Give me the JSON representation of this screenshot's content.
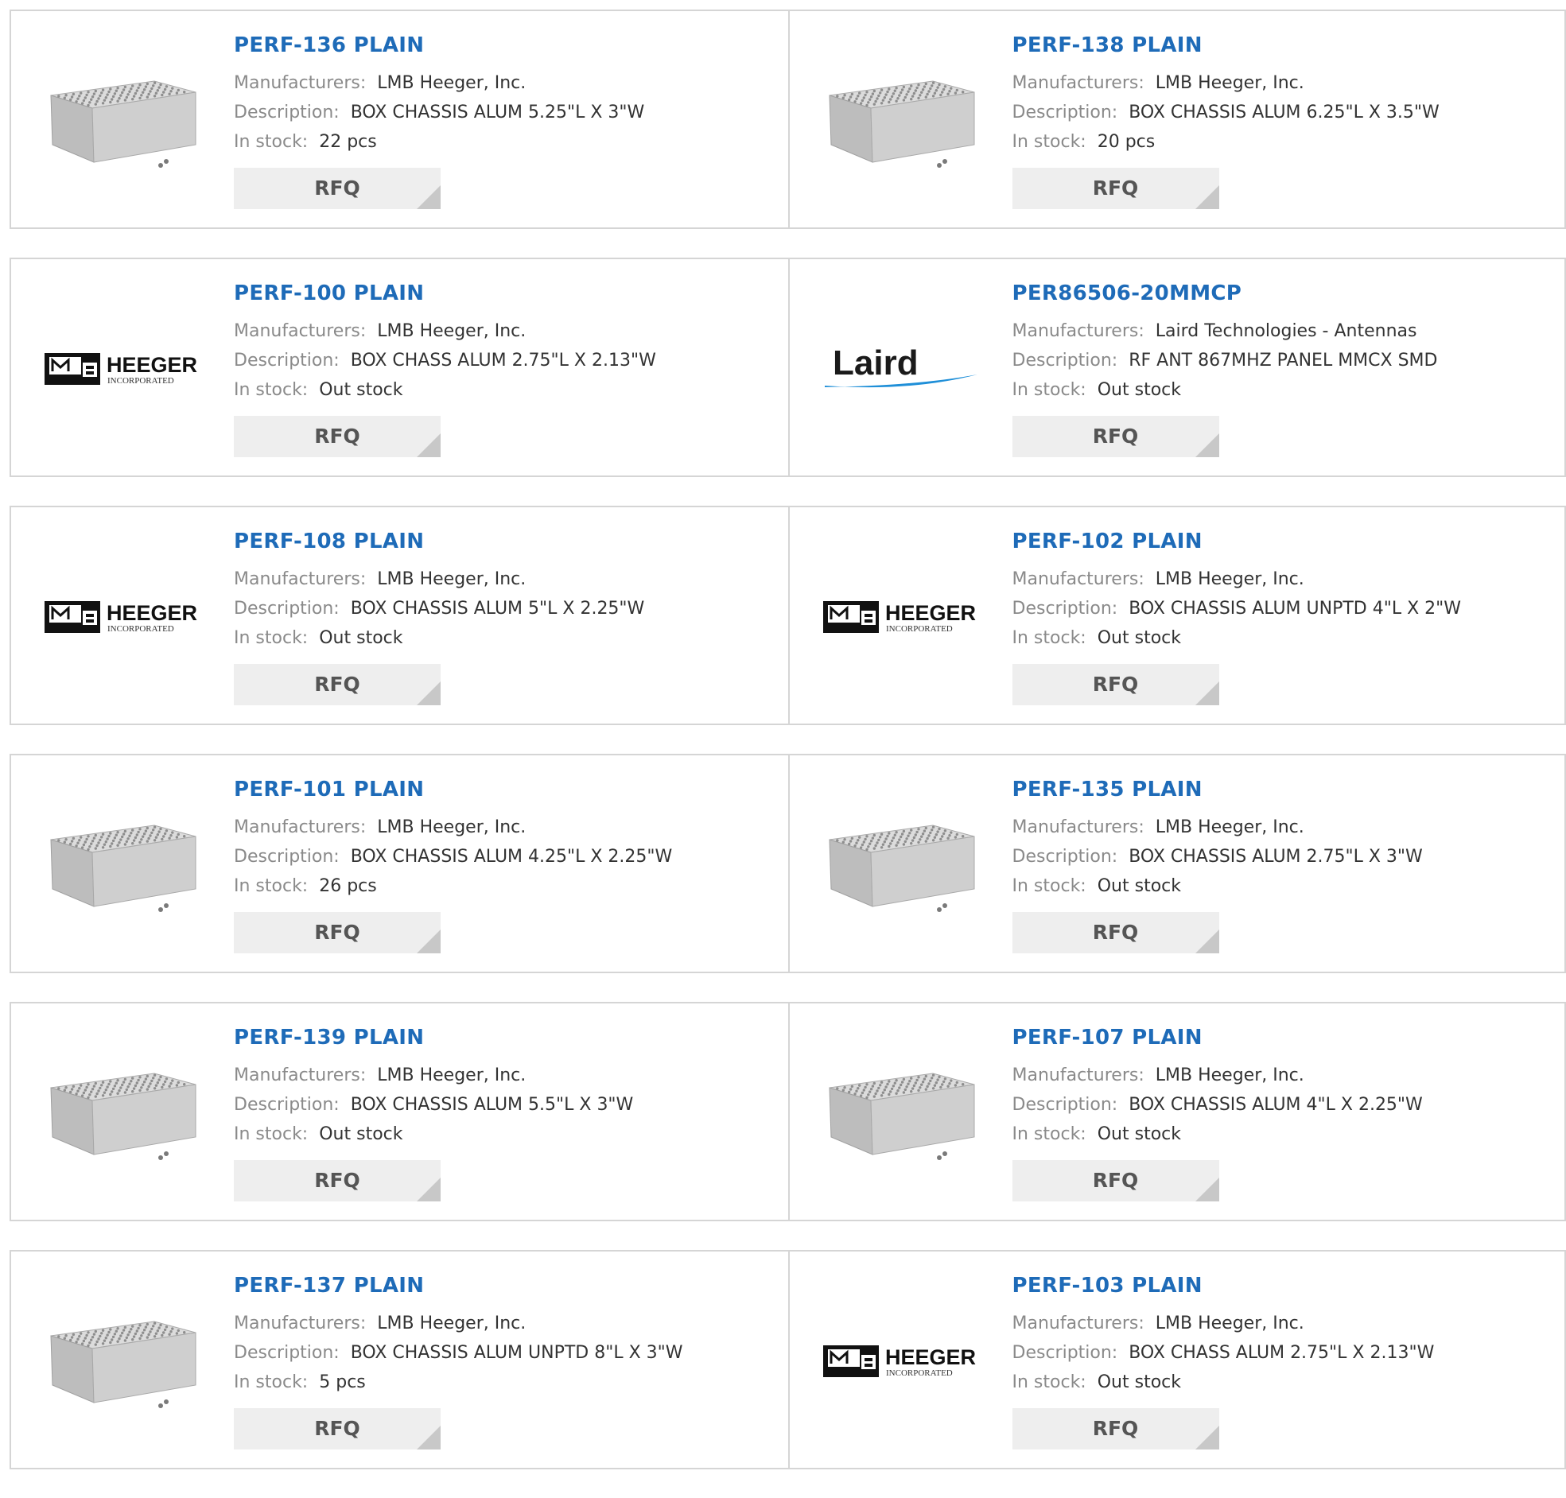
{
  "labels": {
    "manufacturers": "Manufacturers:",
    "description": "Description:",
    "in_stock": "In stock:",
    "rfq": "RFQ"
  },
  "logos": {
    "heeger_word": "HEEGER",
    "heeger_sub": "INCORPORATED",
    "laird_word": "Laird"
  },
  "colors": {
    "title": "#1e6bb8",
    "label": "#8a8a8a",
    "value": "#333333",
    "button_bg": "#eeeeee",
    "border": "#d5d5d5"
  },
  "products": [
    {
      "part": "PERF-136 PLAIN",
      "manufacturer": "LMB Heeger, Inc.",
      "description": "BOX CHASSIS ALUM 5.25\"L X 3\"W",
      "stock": "22 pcs",
      "image": "chassis-box-icon"
    },
    {
      "part": "PERF-138 PLAIN",
      "manufacturer": "LMB Heeger, Inc.",
      "description": "BOX CHASSIS ALUM 6.25\"L X 3.5\"W",
      "stock": "20 pcs",
      "image": "chassis-box-icon"
    },
    {
      "part": "PERF-100 PLAIN",
      "manufacturer": "LMB Heeger, Inc.",
      "description": "BOX CHASS ALUM 2.75\"L X 2.13\"W",
      "stock": "Out stock",
      "image": "heeger-logo"
    },
    {
      "part": "PER86506-20MMCP",
      "manufacturer": "Laird Technologies - Antennas",
      "description": "RF ANT 867MHZ PANEL MMCX SMD",
      "stock": "Out stock",
      "image": "laird-logo"
    },
    {
      "part": "PERF-108 PLAIN",
      "manufacturer": "LMB Heeger, Inc.",
      "description": "BOX CHASSIS ALUM 5\"L X 2.25\"W",
      "stock": "Out stock",
      "image": "heeger-logo"
    },
    {
      "part": "PERF-102 PLAIN",
      "manufacturer": "LMB Heeger, Inc.",
      "description": "BOX CHASSIS ALUM UNPTD 4\"L X 2\"W",
      "stock": "Out stock",
      "image": "heeger-logo"
    },
    {
      "part": "PERF-101 PLAIN",
      "manufacturer": "LMB Heeger, Inc.",
      "description": "BOX CHASSIS ALUM 4.25\"L X 2.25\"W",
      "stock": "26 pcs",
      "image": "chassis-box-icon"
    },
    {
      "part": "PERF-135 PLAIN",
      "manufacturer": "LMB Heeger, Inc.",
      "description": "BOX CHASSIS ALUM 2.75\"L X 3\"W",
      "stock": "Out stock",
      "image": "chassis-box-icon"
    },
    {
      "part": "PERF-139 PLAIN",
      "manufacturer": "LMB Heeger, Inc.",
      "description": "BOX CHASSIS ALUM 5.5\"L X 3\"W",
      "stock": "Out stock",
      "image": "chassis-box-icon"
    },
    {
      "part": "PERF-107 PLAIN",
      "manufacturer": "LMB Heeger, Inc.",
      "description": "BOX CHASSIS ALUM 4\"L X 2.25\"W",
      "stock": "Out stock",
      "image": "chassis-box-icon"
    },
    {
      "part": "PERF-137 PLAIN",
      "manufacturer": "LMB Heeger, Inc.",
      "description": "BOX CHASSIS ALUM UNPTD 8\"L X 3\"W",
      "stock": "5 pcs",
      "image": "chassis-box-icon"
    },
    {
      "part": "PERF-103 PLAIN",
      "manufacturer": "LMB Heeger, Inc.",
      "description": "BOX CHASS ALUM 2.75\"L X 2.13\"W",
      "stock": "Out stock",
      "image": "heeger-logo"
    }
  ]
}
